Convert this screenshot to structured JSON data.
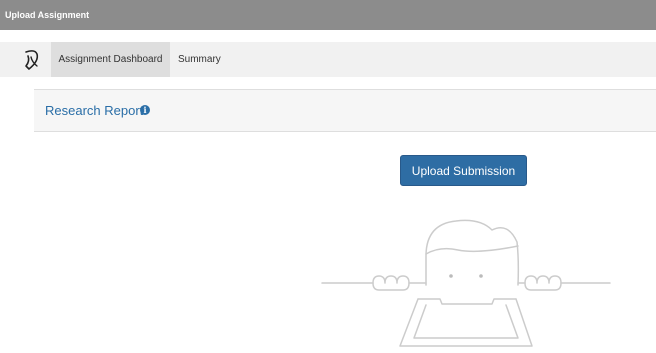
{
  "window": {
    "title": "Upload Assignment"
  },
  "toolbar": {
    "logo_icon": "signature-pen-icon",
    "tabs": [
      {
        "label": "Assignment Dashboard",
        "active": true
      },
      {
        "label": "Summary",
        "active": false
      }
    ]
  },
  "section": {
    "title": "Research Report",
    "info_icon": "info-icon"
  },
  "actions": {
    "upload_label": "Upload Submission"
  },
  "illustration": {
    "name": "empty-inbox-character-illustration"
  },
  "colors": {
    "titlebar_bg": "#8c8c8c",
    "accent_blue": "#2e6da4",
    "link_blue": "#2a6ea7",
    "toolbar_bg": "#f1f1f1",
    "active_tab_bg": "#dedede"
  }
}
